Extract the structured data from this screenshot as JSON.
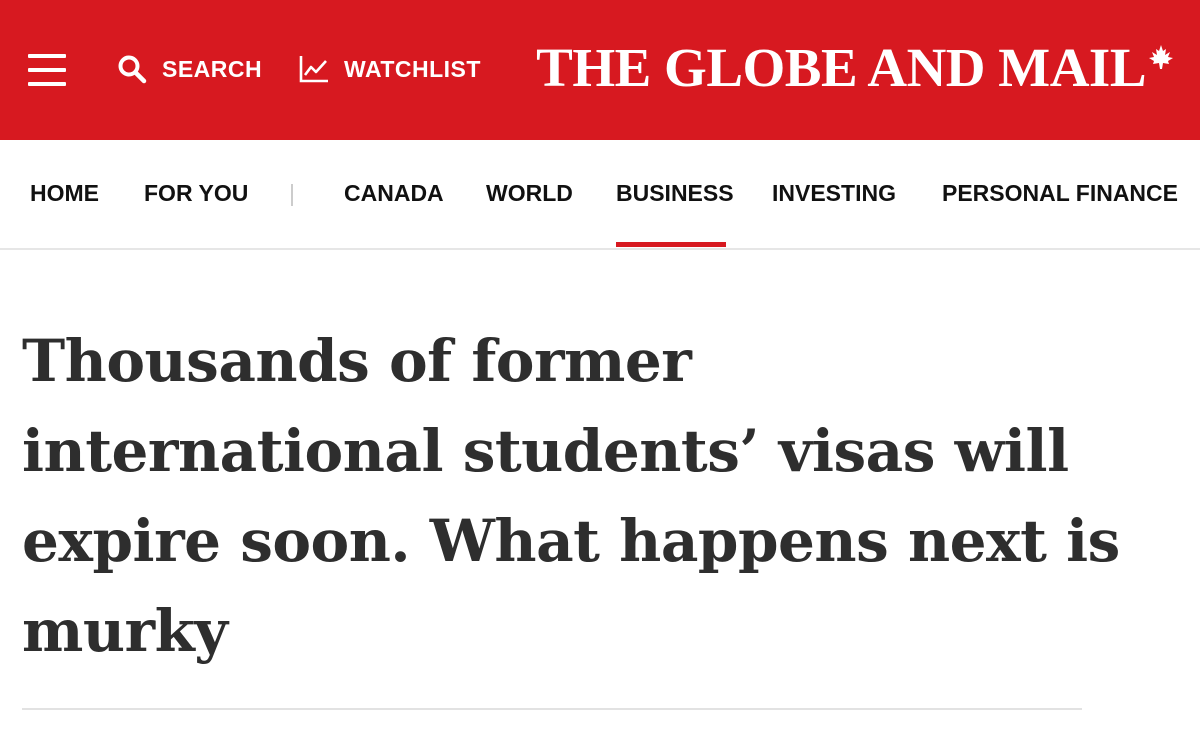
{
  "colors": {
    "brand_red": "#d71920",
    "headline_text": "#2e2e2e",
    "nav_text": "#111111"
  },
  "header": {
    "menu_icon": "hamburger-menu-icon",
    "search": {
      "icon": "search-icon",
      "label": "SEARCH"
    },
    "watchlist": {
      "icon": "chart-line-icon",
      "label": "WATCHLIST"
    },
    "masthead": {
      "title": "THE GLOBE AND MAIL",
      "icon": "maple-leaf-icon"
    }
  },
  "nav": {
    "items": [
      "HOME",
      "FOR YOU",
      "CANADA",
      "WORLD",
      "BUSINESS",
      "INVESTING",
      "PERSONAL FINANCE"
    ],
    "active": "BUSINESS"
  },
  "article": {
    "headline": "Thousands of former international students’ visas will expire soon. What happens next is murky"
  }
}
